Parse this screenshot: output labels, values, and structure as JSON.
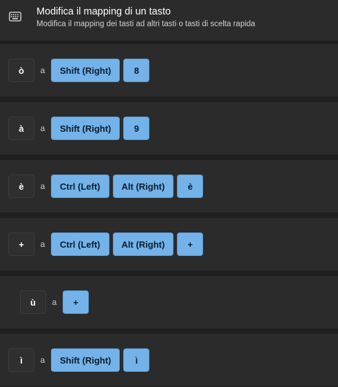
{
  "header": {
    "title": "Modifica il mapping di un tasto",
    "subtitle": "Modifica il mapping dei tasti ad altri tasti o tasti di scelta rapida",
    "icon": "keyboard-icon"
  },
  "separator_label": "a",
  "colors": {
    "background": "#202020",
    "row_background": "#2b2b2b",
    "accent_key": "#73b3ea"
  },
  "mappings": [
    {
      "original": "ò",
      "keys": [
        "Shift (Right)",
        "8"
      ]
    },
    {
      "original": "à",
      "keys": [
        "Shift (Right)",
        "9"
      ]
    },
    {
      "original": "è",
      "keys": [
        "Ctrl (Left)",
        "Alt (Right)",
        "è"
      ]
    },
    {
      "original": "+",
      "keys": [
        "Ctrl (Left)",
        "Alt (Right)",
        "+"
      ]
    },
    {
      "original": "ù",
      "keys": [
        "+"
      ]
    },
    {
      "original": "ì",
      "keys": [
        "Shift (Right)",
        "ì"
      ]
    }
  ]
}
